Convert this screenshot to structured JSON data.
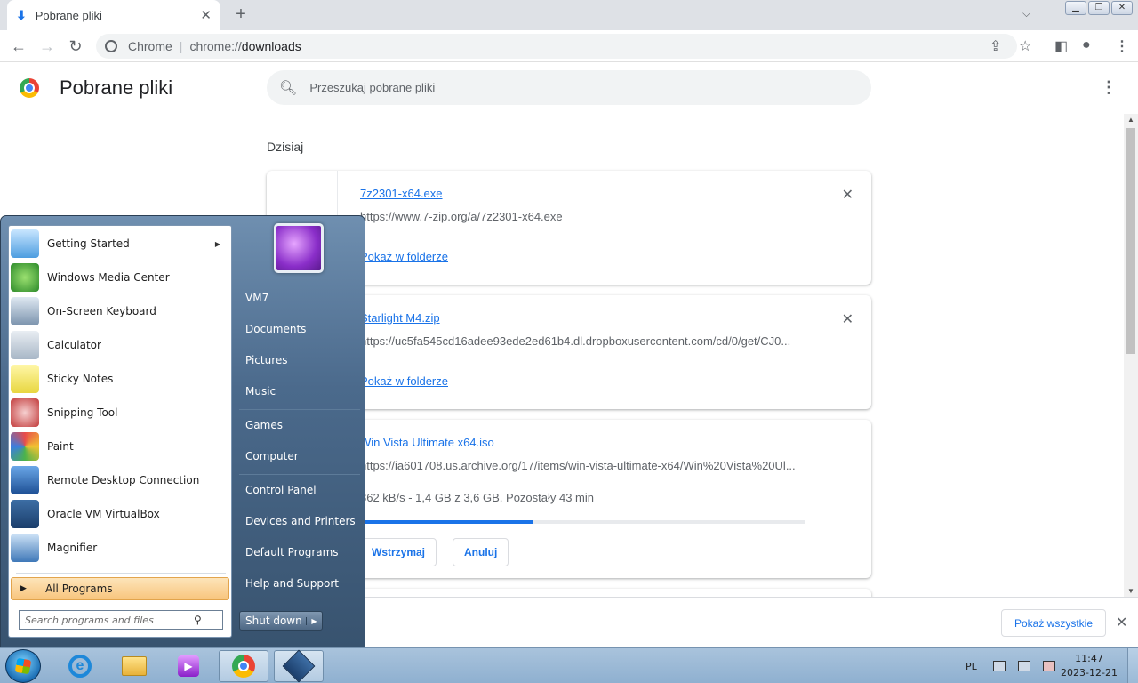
{
  "browser": {
    "tab_title": "Pobrane pliki",
    "omnibox_label": "Chrome",
    "omnibox_url_prefix": "chrome://",
    "omnibox_url_path": "downloads"
  },
  "page": {
    "title": "Pobrane pliki",
    "search_placeholder": "Przeszukaj pobrane pliki",
    "date_header": "Dzisiaj"
  },
  "downloads": [
    {
      "name": "7z2301-x64.exe",
      "url": "https://www.7-zip.org/a/7z2301-x64.exe",
      "link": "Pokaż w folderze"
    },
    {
      "name": "Starlight M4.zip",
      "url": "https://uc5fa545cd16adee93ede2ed61b4.dl.dropboxusercontent.com/cd/0/get/CJ0...",
      "link": "Pokaż w folderze"
    },
    {
      "name": "Win Vista Ultimate x64.iso",
      "url": "https://ia601708.us.archive.org/17/items/win-vista-ultimate-x64/Win%20Vista%20Ul...",
      "status": "862 kB/s - 1,4 GB z 3,6 GB, Pozostały 43 min",
      "progress": 0.39,
      "pause_label": "Wstrzymaj",
      "cancel_label": "Anuluj"
    }
  ],
  "download_bar": {
    "show_all_label": "Pokaż wszystkie"
  },
  "start_menu": {
    "programs": [
      {
        "label": "Getting Started",
        "icon": "getting-started-icon",
        "has_submenu": true
      },
      {
        "label": "Windows Media Center",
        "icon": "media-center-icon"
      },
      {
        "label": "On-Screen Keyboard",
        "icon": "keyboard-icon"
      },
      {
        "label": "Calculator",
        "icon": "calculator-icon"
      },
      {
        "label": "Sticky Notes",
        "icon": "sticky-notes-icon"
      },
      {
        "label": "Snipping Tool",
        "icon": "snipping-tool-icon"
      },
      {
        "label": "Paint",
        "icon": "paint-icon"
      },
      {
        "label": "Remote Desktop Connection",
        "icon": "remote-desktop-icon"
      },
      {
        "label": "Oracle VM VirtualBox",
        "icon": "virtualbox-icon"
      },
      {
        "label": "Magnifier",
        "icon": "magnifier-icon"
      }
    ],
    "all_programs_label": "All Programs",
    "search_placeholder": "Search programs and files",
    "user_links": [
      "VM7",
      "Documents",
      "Pictures",
      "Music"
    ],
    "system_links": [
      "Games",
      "Computer"
    ],
    "settings_links": [
      "Control Panel",
      "Devices and Printers",
      "Default Programs",
      "Help and Support"
    ],
    "shutdown_label": "Shut down"
  },
  "taskbar": {
    "language": "PL",
    "time": "11:47",
    "date": "2023-12-21"
  },
  "colors": {
    "accent": "#1a73e8",
    "taskbar": "#a9c3dc",
    "all_programs_highlight": "#f8c57d"
  }
}
